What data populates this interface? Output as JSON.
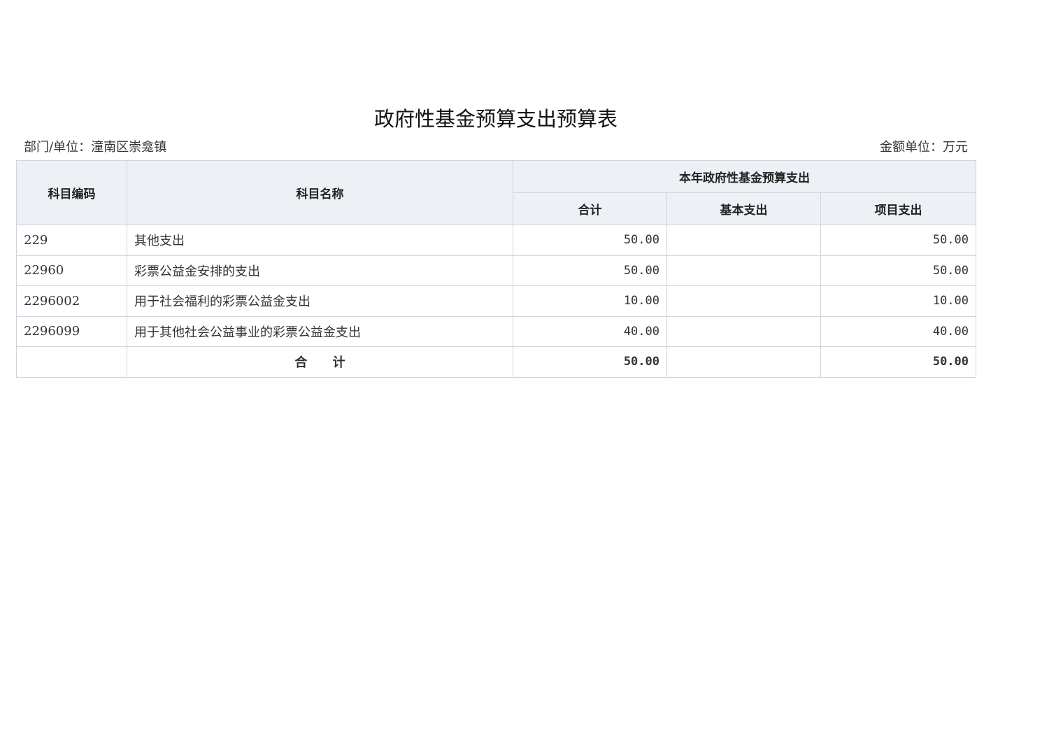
{
  "title": "政府性基金预算支出预算表",
  "dept_label": "部门/单位：潼南区崇龛镇",
  "unit_label": "金额单位：万元",
  "headers": {
    "code": "科目编码",
    "name": "科目名称",
    "group": "本年政府性基金预算支出",
    "total": "合计",
    "basic": "基本支出",
    "project": "项目支出"
  },
  "rows": [
    {
      "code": "229",
      "name": "其他支出",
      "level": 1,
      "total": "50.00",
      "basic": "",
      "project": "50.00"
    },
    {
      "code": "22960",
      "name": "彩票公益金安排的支出",
      "level": 2,
      "total": "50.00",
      "basic": "",
      "project": "50.00"
    },
    {
      "code": "2296002",
      "name": "用于社会福利的彩票公益金支出",
      "level": 3,
      "total": "10.00",
      "basic": "",
      "project": "10.00"
    },
    {
      "code": "2296099",
      "name": "用于其他社会公益事业的彩票公益金支出",
      "level": 3,
      "total": "40.00",
      "basic": "",
      "project": "40.00"
    }
  ],
  "summary": {
    "label": "合 计",
    "total": "50.00",
    "basic": "",
    "project": "50.00"
  }
}
